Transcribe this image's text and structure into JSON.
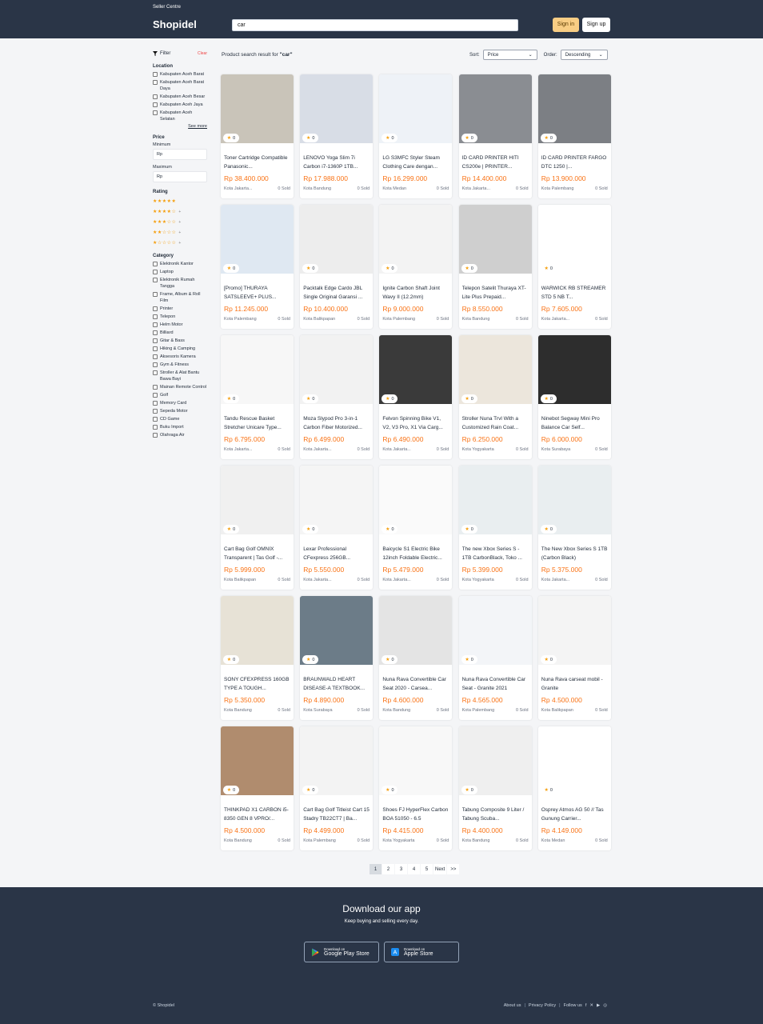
{
  "header": {
    "seller_link": "Seller Centre",
    "logo": "Shopidel",
    "search_value": "car",
    "signin": "Sign in",
    "signup": "Sign up"
  },
  "sidebar": {
    "filter": "Filter",
    "clear": "Clear",
    "location_title": "Location",
    "locations": [
      "Kabupaten Aceh Barat",
      "Kabupaten Aceh Barat Daya",
      "Kabupaten Aceh Besar",
      "Kabupaten Aceh Jaya",
      "Kabupaten Aceh Selatan"
    ],
    "see_more": "See more",
    "price_title": "Price",
    "minimum": "Minimum",
    "maximum": "Maximum",
    "currency": "Rp",
    "rating_title": "Rating",
    "ratings": [
      "★★★★★",
      "★★★★☆",
      "★★★☆☆",
      "★★☆☆☆",
      "★☆☆☆☆"
    ],
    "rating_up": "+",
    "category_title": "Category",
    "categories": [
      "Elektronik Kantor",
      "Laptop",
      "Elektronik Rumah Tangga",
      "Frame, Album & Roll Film",
      "Printer",
      "Telepon",
      "Helm Motor",
      "Billiard",
      "Gitar & Bass",
      "Hiking & Camping",
      "Aksesoris Kamera",
      "Gym & Fitness",
      "Stroller & Alat Bantu Bawa Bayi",
      "Mainan Remote Control",
      "Golf",
      "Memory Card",
      "Sepeda Motor",
      "CD Game",
      "Buku Import",
      "Olahraga Air"
    ]
  },
  "results": {
    "prefix": "Product search result for ",
    "query": "\"car\"",
    "sort_label": "Sort:",
    "sort_value": "Price",
    "order_label": "Order:",
    "order_value": "Descending"
  },
  "products": [
    {
      "name": "Toner Cartridge Compatible Panasonic...",
      "price": "Rp 38.400.000",
      "location": "Kota Jakarta...",
      "sold": "0 Sold",
      "rating": "0",
      "bg": "#c9c4b9"
    },
    {
      "name": "LENOVO Yoga Slim 7i Carbon i7-1360P 1TB...",
      "price": "Rp 17.988.000",
      "location": "Kota Bandung",
      "sold": "0 Sold",
      "rating": "0",
      "bg": "#d8dde6"
    },
    {
      "name": "LG S3MFC Styler Steam Clothing Care dengan...",
      "price": "Rp 16.299.000",
      "location": "Kota Medan",
      "sold": "0 Sold",
      "rating": "0",
      "bg": "#eef2f7"
    },
    {
      "name": "ID CARD PRINTER HITI CS200e | PRINTER...",
      "price": "Rp 14.400.000",
      "location": "Kota Jakarta...",
      "sold": "0 Sold",
      "rating": "0",
      "bg": "#8a8d92"
    },
    {
      "name": "ID CARD PRINTER FARGO DTC 1250 |...",
      "price": "Rp 13.900.000",
      "location": "Kota Palembang",
      "sold": "0 Sold",
      "rating": "0",
      "bg": "#7c7f84"
    },
    {
      "name": "[Promo] THURAYA SATSLEEVE+ PLUS...",
      "price": "Rp 11.245.000",
      "location": "Kota Palembang",
      "sold": "0 Sold",
      "rating": "0",
      "bg": "#dfe8f2"
    },
    {
      "name": "Packtalk Edge Cardo JBL Single Original Garansi ...",
      "price": "Rp 10.400.000",
      "location": "Kota Balikpapan",
      "sold": "0 Sold",
      "rating": "0",
      "bg": "#ededed"
    },
    {
      "name": "Ignite Carbon Shaft Joint Wavy II (12.2mm)",
      "price": "Rp 9.000.000",
      "location": "Kota Palembang",
      "sold": "0 Sold",
      "rating": "0",
      "bg": "#f3f3f3"
    },
    {
      "name": "Telepon Satelit Thuraya XT-Lite Plus Prepaid...",
      "price": "Rp 8.550.000",
      "location": "Kota Bandung",
      "sold": "0 Sold",
      "rating": "0",
      "bg": "#cfcfcf"
    },
    {
      "name": "WARWICK RB STREAMER STD 5 NB T...",
      "price": "Rp 7.605.000",
      "location": "Kota Jakarta...",
      "sold": "0 Sold",
      "rating": "0",
      "bg": "#ffffff"
    },
    {
      "name": "Tandu Rescue Basket Stretcher Unicare Type...",
      "price": "Rp 6.795.000",
      "location": "Kota Jakarta...",
      "sold": "0 Sold",
      "rating": "0",
      "bg": "#f7f7f7"
    },
    {
      "name": "Moza Slypod Pro 3-in-1 Carbon Fiber Motorized...",
      "price": "Rp 6.499.000",
      "location": "Kota Jakarta...",
      "sold": "0 Sold",
      "rating": "0",
      "bg": "#f2f2f2"
    },
    {
      "name": "Felvon Spinning Bike V1, V2, V3 Pro, X1 Via Carg...",
      "price": "Rp 6.490.000",
      "location": "Kota Jakarta...",
      "sold": "0 Sold",
      "rating": "0",
      "bg": "#3a3a3a"
    },
    {
      "name": "Stroller Nuna Trvl With a Customized Rain Coat...",
      "price": "Rp 6.250.000",
      "location": "Kota Yogyakarta",
      "sold": "0 Sold",
      "rating": "0",
      "bg": "#ece6dc"
    },
    {
      "name": "Ninebot Segway Mini Pro Balance Car Self...",
      "price": "Rp 6.000.000",
      "location": "Kota Surabaya",
      "sold": "0 Sold",
      "rating": "0",
      "bg": "#2d2d2d"
    },
    {
      "name": "Cart Bag Golf OMNIX Transparent | Tas Golf -...",
      "price": "Rp 5.999.000",
      "location": "Kota Balikpapan",
      "sold": "0 Sold",
      "rating": "0",
      "bg": "#f0f0f0"
    },
    {
      "name": "Lexar Professional CFexpress 256GB...",
      "price": "Rp 5.550.000",
      "location": "Kota Jakarta...",
      "sold": "0 Sold",
      "rating": "0",
      "bg": "#f5f5f5"
    },
    {
      "name": "Baicycle S1 Electric Bike 12inch Foldable Electric...",
      "price": "Rp 5.479.000",
      "location": "Kota Jakarta...",
      "sold": "0 Sold",
      "rating": "0",
      "bg": "#fafafa"
    },
    {
      "name": "The new Xbox Series S - 1TB CarbonBlack, Toko ...",
      "price": "Rp 5.399.000",
      "location": "Kota Yogyakarta",
      "sold": "0 Sold",
      "rating": "0",
      "bg": "#e9eef0"
    },
    {
      "name": "The New Xbox Series S 1TB (Carbon Black)",
      "price": "Rp 5.375.000",
      "location": "Kota Jakarta...",
      "sold": "0 Sold",
      "rating": "0",
      "bg": "#e9eef0"
    },
    {
      "name": "SONY CFEXPRESS 160GB TYPE A TOUGH...",
      "price": "Rp 5.350.000",
      "location": "Kota Bandung",
      "sold": "0 Sold",
      "rating": "0",
      "bg": "#e7e2d6"
    },
    {
      "name": "BRAUNWALD HEART DISEASE-A TEXTBOOK...",
      "price": "Rp 4.890.000",
      "location": "Kota Surabaya",
      "sold": "0 Sold",
      "rating": "0",
      "bg": "#6c7c88"
    },
    {
      "name": "Nuna Rava Convertible Car Seat 2020 - Carsea...",
      "price": "Rp 4.600.000",
      "location": "Kota Bandung",
      "sold": "0 Sold",
      "rating": "0",
      "bg": "#e4e4e4"
    },
    {
      "name": "Nuna Rava Convertible Car Seat - Granite 2021",
      "price": "Rp 4.565.000",
      "location": "Kota Palembang",
      "sold": "0 Sold",
      "rating": "0",
      "bg": "#f3f5f8"
    },
    {
      "name": "Nuna Rava carseat mobil - Granite",
      "price": "Rp 4.500.000",
      "location": "Kota Balikpapan",
      "sold": "0 Sold",
      "rating": "0",
      "bg": "#f4f4f4"
    },
    {
      "name": "THINKPAD X1 CARBON i5-8350 GEN 8 VPRO/...",
      "price": "Rp 4.500.000",
      "location": "Kota Bandung",
      "sold": "0 Sold",
      "rating": "0",
      "bg": "#b08c6e"
    },
    {
      "name": "Cart Bag Golf Titleist Cart 15 Stadry TB22CT7 | Ba...",
      "price": "Rp 4.499.000",
      "location": "Kota Palembang",
      "sold": "0 Sold",
      "rating": "0",
      "bg": "#f3f3f3"
    },
    {
      "name": "Shoes FJ HyperFlex Carbon BOA 51050 - 6.5",
      "price": "Rp 4.415.000",
      "location": "Kota Yogyakarta",
      "sold": "0 Sold",
      "rating": "0",
      "bg": "#f8f8f8"
    },
    {
      "name": "Tabung Composite 9 Liter / Tabung Scuba...",
      "price": "Rp 4.400.000",
      "location": "Kota Bandung",
      "sold": "0 Sold",
      "rating": "0",
      "bg": "#efefef"
    },
    {
      "name": "Osprey Atmos AG 50 // Tas Gunung Carrier...",
      "price": "Rp 4.149.000",
      "location": "Kota Medan",
      "sold": "0 Sold",
      "rating": "0",
      "bg": "#ffffff"
    }
  ],
  "pagination": {
    "pages": [
      "1",
      "2",
      "3",
      "4",
      "5"
    ],
    "next": "Next",
    "last": ">>"
  },
  "footer": {
    "title": "Download our app",
    "subtitle": "Keep buying and selling every day.",
    "google_small": "Download on",
    "google_big": "Google Play Store",
    "apple_small": "Download on",
    "apple_big": "Apple Store",
    "copyright": "© Shopidel",
    "about": "About us",
    "privacy": "Privacy Policy",
    "follow": "Follow us"
  }
}
